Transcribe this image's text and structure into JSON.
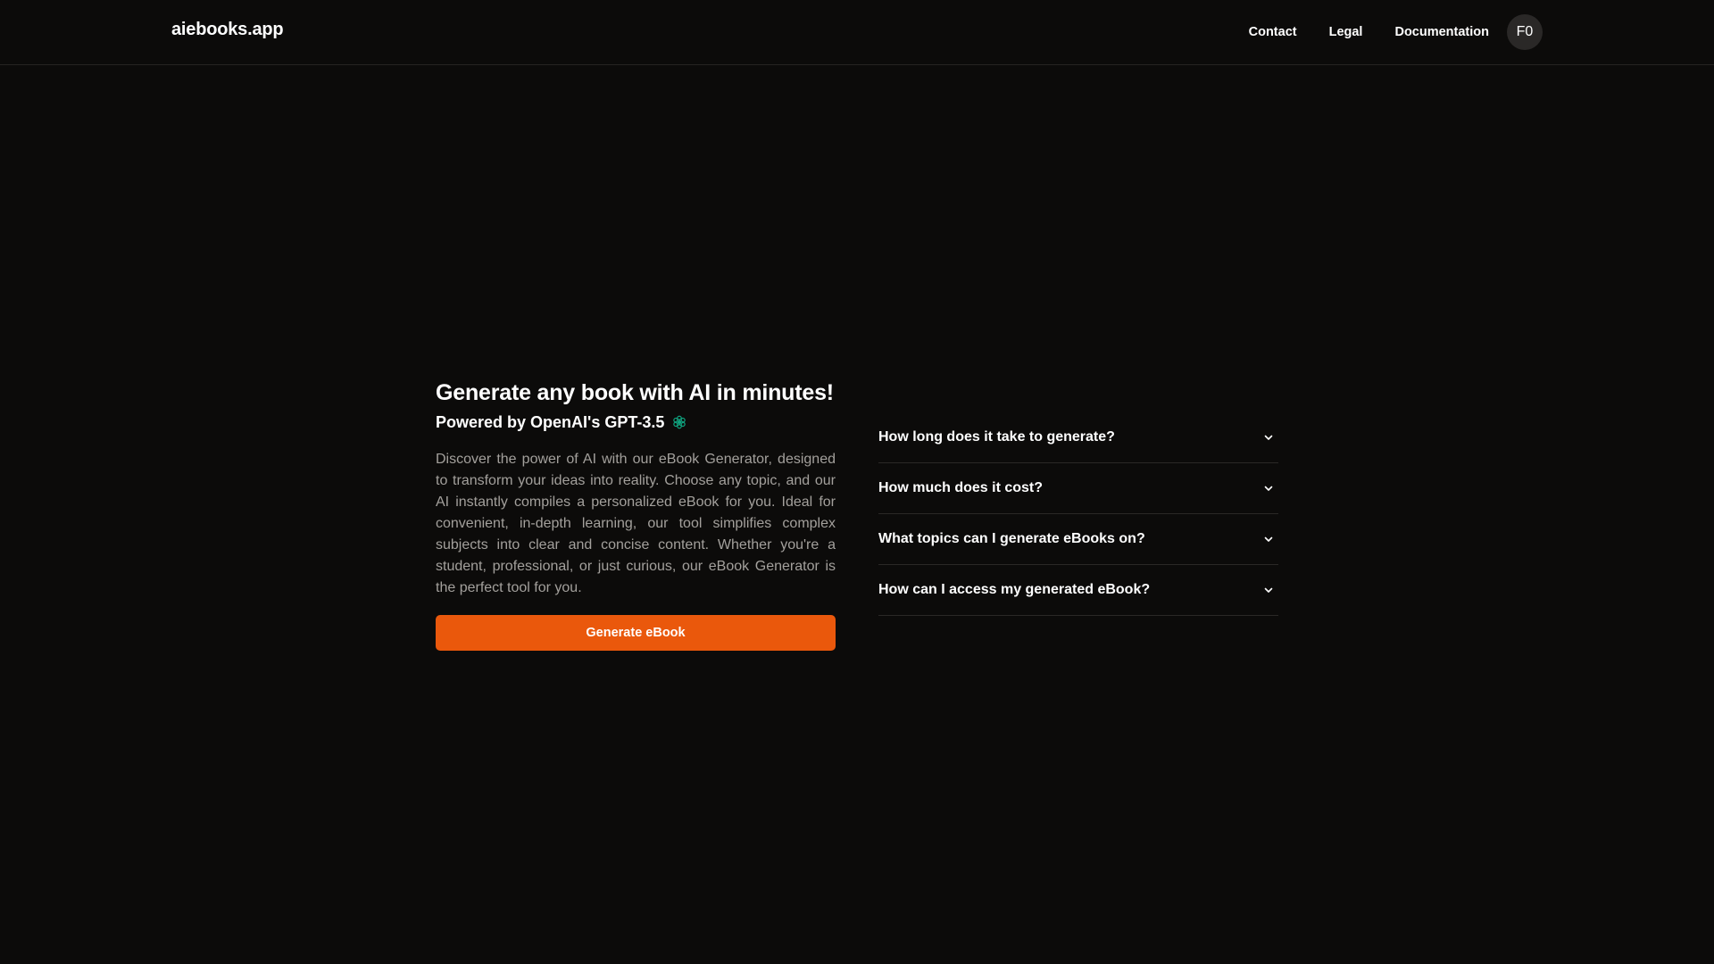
{
  "header": {
    "brand": "aiebooks.app",
    "nav": [
      {
        "label": "Contact"
      },
      {
        "label": "Legal"
      },
      {
        "label": "Documentation"
      }
    ],
    "avatar_initials": "F0"
  },
  "hero": {
    "title": "Generate any book with AI in minutes!",
    "subtitle": "Powered by OpenAI's GPT-3.5",
    "subtitle_icon": "openai-icon",
    "description": "Discover the power of AI with our eBook Generator, designed to transform your ideas into reality. Choose any topic, and our AI instantly compiles a personalized eBook for you. Ideal for convenient, in-depth learning, our tool simplifies complex subjects into clear and concise content. Whether you're a student, professional, or just curious, our eBook Generator is the perfect tool for you.",
    "cta_label": "Generate eBook"
  },
  "faq": {
    "items": [
      {
        "question": "How long does it take to generate?"
      },
      {
        "question": "How much does it cost?"
      },
      {
        "question": "What topics can I generate eBooks on?"
      },
      {
        "question": "How can I access my generated eBook?"
      }
    ]
  },
  "colors": {
    "background": "#0c0b0a",
    "accent": "#ea580c",
    "openai_icon": "#10a37f",
    "muted_text": "#a3a09c"
  }
}
